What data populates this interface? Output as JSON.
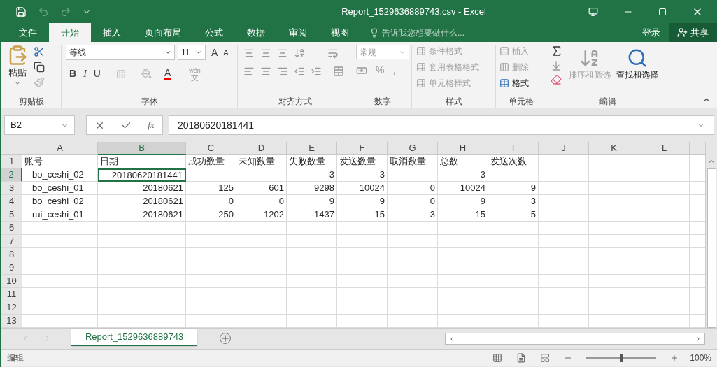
{
  "window": {
    "title": "Report_1529636889743.csv - Excel"
  },
  "menu_tabs": [
    {
      "label": "文件",
      "selected": false
    },
    {
      "label": "开始",
      "selected": true
    },
    {
      "label": "插入",
      "selected": false
    },
    {
      "label": "页面布局",
      "selected": false
    },
    {
      "label": "公式",
      "selected": false
    },
    {
      "label": "数据",
      "selected": false
    },
    {
      "label": "审阅",
      "selected": false
    },
    {
      "label": "视图",
      "selected": false
    }
  ],
  "tell_me": {
    "placeholder": "告诉我您想要做什么..."
  },
  "account": {
    "login": "登录",
    "share": "共享"
  },
  "ribbon": {
    "clipboard": {
      "label": "剪贴板",
      "paste": "粘贴"
    },
    "font": {
      "label": "字体",
      "font_name": "等线",
      "font_size": "11",
      "bold": "B",
      "italic": "I",
      "underline": "U",
      "grow_font": "A",
      "shrink_font": "A",
      "font_color": "A",
      "phonetic_top": "wén",
      "phonetic_bottom": "文"
    },
    "alignment": {
      "label": "对齐方式"
    },
    "number": {
      "label": "数字",
      "format": "常规",
      "percent": "%",
      "comma": ","
    },
    "styles": {
      "label": "样式",
      "items": [
        {
          "label": "条件格式",
          "disabled": true
        },
        {
          "label": "套用表格格式",
          "disabled": true
        },
        {
          "label": "单元格样式",
          "disabled": true
        }
      ]
    },
    "cells": {
      "label": "单元格",
      "items": [
        {
          "label": "插入",
          "disabled": true
        },
        {
          "label": "删除",
          "disabled": true
        },
        {
          "label": "格式",
          "disabled": false
        }
      ]
    },
    "editing": {
      "label": "编辑",
      "items": [
        {
          "label": "排序和筛选",
          "disabled": true
        },
        {
          "label": "查找和选择",
          "disabled": false
        }
      ]
    }
  },
  "formula_bar": {
    "name_box": "B2",
    "function_symbol": "fx",
    "value": "20180620181441"
  },
  "sheet": {
    "columns": [
      {
        "label": "A",
        "selected": false
      },
      {
        "label": "B",
        "selected": true
      },
      {
        "label": "C",
        "selected": false
      },
      {
        "label": "D",
        "selected": false
      },
      {
        "label": "E",
        "selected": false
      },
      {
        "label": "F",
        "selected": false
      },
      {
        "label": "G",
        "selected": false
      },
      {
        "label": "H",
        "selected": false
      },
      {
        "label": "I",
        "selected": false
      },
      {
        "label": "J",
        "selected": false
      },
      {
        "label": "K",
        "selected": false
      },
      {
        "label": "L",
        "selected": false
      }
    ],
    "rows": [
      {
        "label": "1",
        "selected": false,
        "cells": [
          {
            "text": "账号",
            "selected": false
          },
          {
            "text": "日期",
            "selected": false
          },
          {
            "text": "成功数量",
            "selected": false
          },
          {
            "text": "未知数量",
            "selected": false
          },
          {
            "text": "失败数量",
            "selected": false
          },
          {
            "text": "发送数量",
            "selected": false
          },
          {
            "text": "取消数量",
            "selected": false
          },
          {
            "text": "总数",
            "selected": false
          },
          {
            "text": "发送次数",
            "selected": false
          }
        ]
      },
      {
        "label": "2",
        "selected": true,
        "cells": [
          {
            "text": "bo_ceshi_02",
            "selected": false
          },
          {
            "text": "20180620181441",
            "selected": true
          },
          null,
          null,
          {
            "text": "3",
            "selected": false
          },
          {
            "text": "3",
            "selected": false
          },
          null,
          {
            "text": "3",
            "selected": false
          },
          null
        ]
      },
      {
        "label": "3",
        "selected": false,
        "cells": [
          {
            "text": "bo_ceshi_01",
            "selected": false
          },
          {
            "text": "20180621",
            "selected": false
          },
          {
            "text": "125",
            "selected": false
          },
          {
            "text": "601",
            "selected": false
          },
          {
            "text": "9298",
            "selected": false
          },
          {
            "text": "10024",
            "selected": false
          },
          {
            "text": "0",
            "selected": false
          },
          {
            "text": "10024",
            "selected": false
          },
          {
            "text": "9",
            "selected": false
          }
        ]
      },
      {
        "label": "4",
        "selected": false,
        "cells": [
          {
            "text": "bo_ceshi_02",
            "selected": false
          },
          {
            "text": "20180621",
            "selected": false
          },
          {
            "text": "0",
            "selected": false
          },
          {
            "text": "0",
            "selected": false
          },
          {
            "text": "9",
            "selected": false
          },
          {
            "text": "9",
            "selected": false
          },
          {
            "text": "0",
            "selected": false
          },
          {
            "text": "9",
            "selected": false
          },
          {
            "text": "3",
            "selected": false
          }
        ]
      },
      {
        "label": "5",
        "selected": false,
        "cells": [
          {
            "text": "rui_ceshi_01",
            "selected": false
          },
          {
            "text": "20180621",
            "selected": false
          },
          {
            "text": "250",
            "selected": false
          },
          {
            "text": "1202",
            "selected": false
          },
          {
            "text": "-1437",
            "selected": false
          },
          {
            "text": "15",
            "selected": false
          },
          {
            "text": "3",
            "selected": false
          },
          {
            "text": "15",
            "selected": false
          },
          {
            "text": "5",
            "selected": false
          }
        ]
      },
      {
        "label": "6",
        "selected": false,
        "cells": []
      },
      {
        "label": "7",
        "selected": false,
        "cells": []
      },
      {
        "label": "8",
        "selected": false,
        "cells": []
      },
      {
        "label": "9",
        "selected": false,
        "cells": []
      },
      {
        "label": "10",
        "selected": false,
        "cells": []
      },
      {
        "label": "11",
        "selected": false,
        "cells": []
      },
      {
        "label": "12",
        "selected": false,
        "cells": []
      },
      {
        "label": "13",
        "selected": false,
        "cells": []
      }
    ]
  },
  "sheet_tabs": [
    {
      "label": "Report_1529636889743",
      "selected": true
    }
  ],
  "status_bar": {
    "mode": "编辑",
    "zoom_slider": {
      "level": 0.5
    },
    "zoom": "100%"
  }
}
